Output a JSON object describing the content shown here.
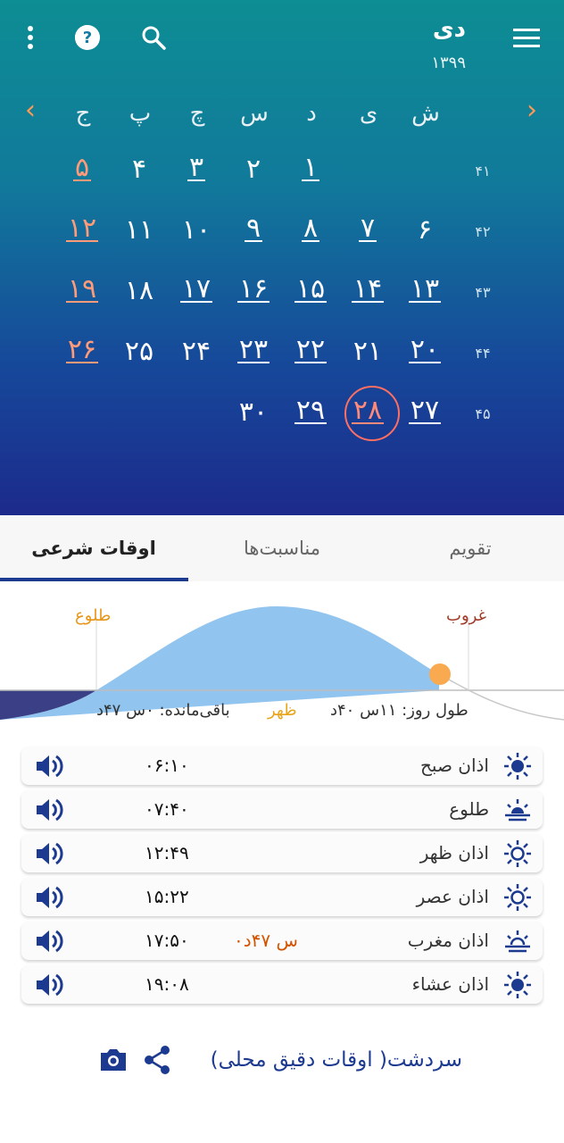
{
  "header": {
    "month": "دی",
    "year": "۱۳۹۹",
    "prev_arrow": "‹",
    "next_arrow": "›",
    "weekdays": [
      "ش",
      "ی",
      "د",
      "س",
      "چ",
      "پ",
      "ج"
    ],
    "week_numbers": [
      "۴۱",
      "۴۲",
      "۴۳",
      "۴۴",
      "۴۵"
    ],
    "weeks": [
      [
        "",
        "۱",
        "۲",
        "۳",
        "۴",
        "۵"
      ],
      [
        "۶",
        "۷",
        "۸",
        "۹",
        "۱۰",
        "۱۱",
        "۱۲"
      ],
      [
        "۱۳",
        "۱۴",
        "۱۵",
        "۱۶",
        "۱۷",
        "۱۸",
        "۱۹"
      ],
      [
        "۲۰",
        "۲۱",
        "۲۲",
        "۲۳",
        "۲۴",
        "۲۵",
        "۲۶"
      ],
      [
        "۲۷",
        "۲۸",
        "۲۹",
        "۳۰"
      ]
    ],
    "today": "۲۸",
    "icons": [
      "more-vert-icon",
      "help-icon",
      "search-icon",
      "menu-icon"
    ]
  },
  "tabs": {
    "calendar": "تقویم",
    "events": "مناسبت‌ها",
    "prayer_times": "اوقات شرعی"
  },
  "sun": {
    "sunrise_label": "طلوع",
    "sunset_label": "غروب",
    "noon_label": "ظهر",
    "day_length": "طول روز: ۱۱س ۴۰د",
    "remaining": "باقی‌مانده: ۰س ۴۷د"
  },
  "prayers": [
    {
      "name": "اذان صبح",
      "time": "۰۶:۱۰",
      "remain": "",
      "icon": "sun-icon"
    },
    {
      "name": "طلوع",
      "time": "۰۷:۴۰",
      "remain": "",
      "icon": "sunrise-icon"
    },
    {
      "name": "اذان ظهر",
      "time": "۱۲:۴۹",
      "remain": "",
      "icon": "sun-outline-icon"
    },
    {
      "name": "اذان عصر",
      "time": "۱۵:۲۲",
      "remain": "",
      "icon": "sun-outline-icon"
    },
    {
      "name": "اذان مغرب",
      "time": "۱۷:۵۰",
      "remain": "۰س ۴۷د",
      "icon": "sunset-icon"
    },
    {
      "name": "اذان عشاء",
      "time": "۱۹:۰۸",
      "remain": "",
      "icon": "sun-icon"
    }
  ],
  "footer": {
    "city": "سردشت( اوقات دقیق محلی)"
  },
  "colors": {
    "accent": "#1c3a8f",
    "holiday": "#ff9b79",
    "sun": "#f9a94f",
    "sky": "#91c5ef"
  }
}
